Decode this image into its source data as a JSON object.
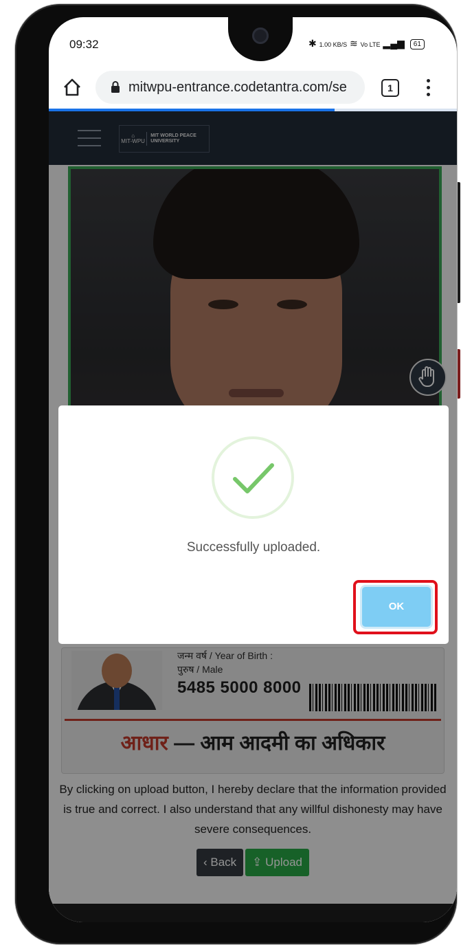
{
  "status_bar": {
    "time": "09:32",
    "net_speed": "1.00 KB/S",
    "signal_text": "Vo LTE",
    "battery": "61"
  },
  "browser": {
    "url": "mitwpu-entrance.codetantra.com/se",
    "tab_count": "1",
    "progress_fraction": 0.7
  },
  "header": {
    "logo_small": "MIT-WPU",
    "logo_name": "MIT WORLD PEACE UNIVERSITY"
  },
  "id_card": {
    "year_of_birth": "जन्म वर्ष / Year of Birth :",
    "gender": "पुरुष / Male",
    "uid": "5485 5000 8000",
    "tagline_red": "आधार",
    "tagline_rest": " — आम आदमी का अधिकार"
  },
  "declaration": "By clicking on upload button, I hereby declare that the information provided is true and correct. I also understand that any willful dishonesty may have severe consequences.",
  "buttons": {
    "back": "‹ Back",
    "upload": "Upload"
  },
  "dialog": {
    "message": "Successfully uploaded.",
    "ok_label": "OK"
  },
  "colors": {
    "nav_bg": "#212b38",
    "success_green": "#77c76a",
    "ok_button": "#7ecdf4",
    "highlight_red": "#e0101b",
    "upload_green": "#28a745"
  }
}
